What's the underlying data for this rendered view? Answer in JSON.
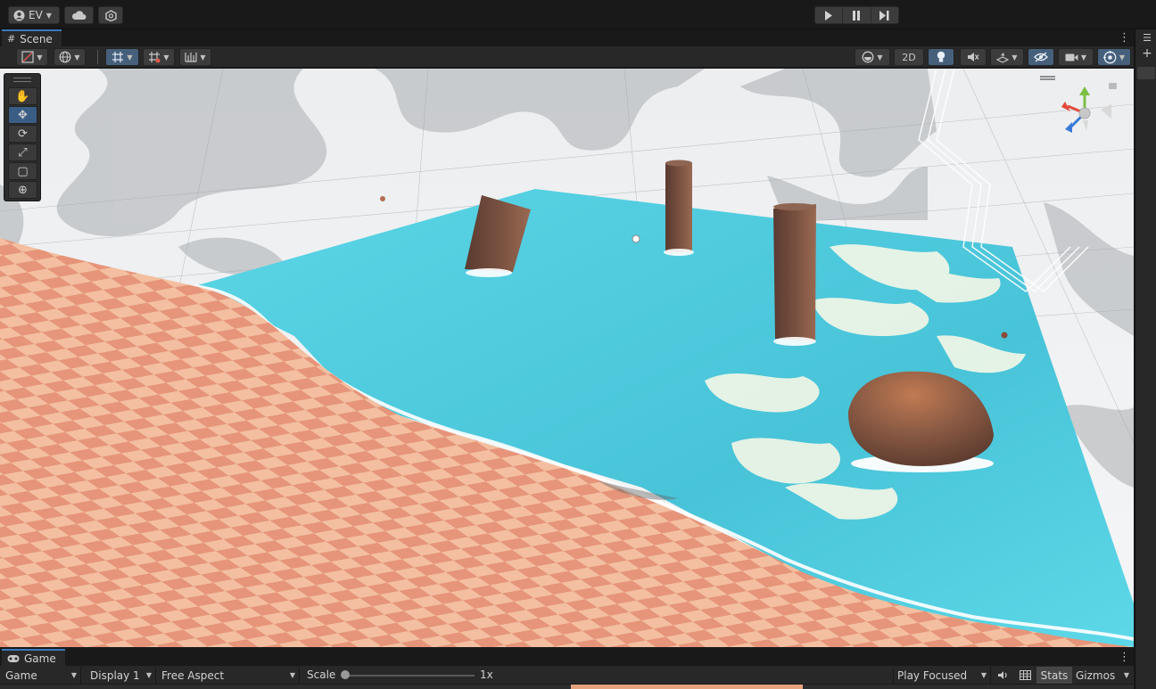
{
  "topbar": {
    "account_label": "EV",
    "account_icon": "user-circle-icon",
    "cloud_icon": "cloud-icon",
    "collab_icon": "collab-icon",
    "play_icon": "play-icon",
    "pause_icon": "pause-icon",
    "step_icon": "step-icon"
  },
  "scene": {
    "tab_label": "Scene",
    "tab_icon": "grid-icon",
    "menu_glyph": "⋮",
    "toolbar": {
      "draw_mode_icon": "shaded-icon",
      "global_icon": "globe-icon",
      "grid_snap_icon": "grid-snap-icon",
      "increment_snap_icon": "snap-increment-icon",
      "ruler_icon": "ruler-icon",
      "render_mode_icon": "sphere-icon",
      "mode_2d_label": "2D",
      "lighting_icon": "lightbulb-icon",
      "audio_icon": "audio-mute-icon",
      "effects_icon": "effects-icon",
      "visibility_icon": "hidden-eye-icon",
      "camera_icon": "camera-icon",
      "gizmo_icon": "gizmo-toggle-icon"
    },
    "tools": [
      {
        "name": "view-tool",
        "icon": "hand-icon",
        "glyph": "✋",
        "active": false
      },
      {
        "name": "move-tool",
        "icon": "move-icon",
        "glyph": "✥",
        "active": true
      },
      {
        "name": "rotate-tool",
        "icon": "rotate-icon",
        "glyph": "⟳",
        "active": false
      },
      {
        "name": "scale-tool",
        "icon": "scale-icon",
        "glyph": "⤢",
        "active": false
      },
      {
        "name": "rect-tool",
        "icon": "rect-icon",
        "glyph": "▢",
        "active": false
      },
      {
        "name": "transform-tool",
        "icon": "transform-icon",
        "glyph": "⊕",
        "active": false
      }
    ],
    "colors": {
      "water": "#5cd2e0",
      "sand_light": "#f3bfa0",
      "sand_dark": "#e38e6e",
      "rock": "#7a5241",
      "sky": "#eef0f2",
      "active_blue": "#3a79bb"
    }
  },
  "game": {
    "tab_label": "Game",
    "tab_icon": "gamepad-icon",
    "menu_glyph": "⋮",
    "view_select": "Game",
    "display_select": "Display 1",
    "aspect_select": "Free Aspect",
    "scale_label": "Scale",
    "scale_value": "1x",
    "scale_fraction": 0.0,
    "play_mode_select": "Play Focused",
    "audio_icon": "speaker-icon",
    "stats_grid_icon": "grid-toggle-icon",
    "stats_label": "Stats",
    "gizmos_label": "Gizmos"
  },
  "right_panel": {
    "list_icon": "list-icon",
    "add_icon": "plus-icon",
    "add_glyph": "+",
    "list_glyph": "☰"
  }
}
